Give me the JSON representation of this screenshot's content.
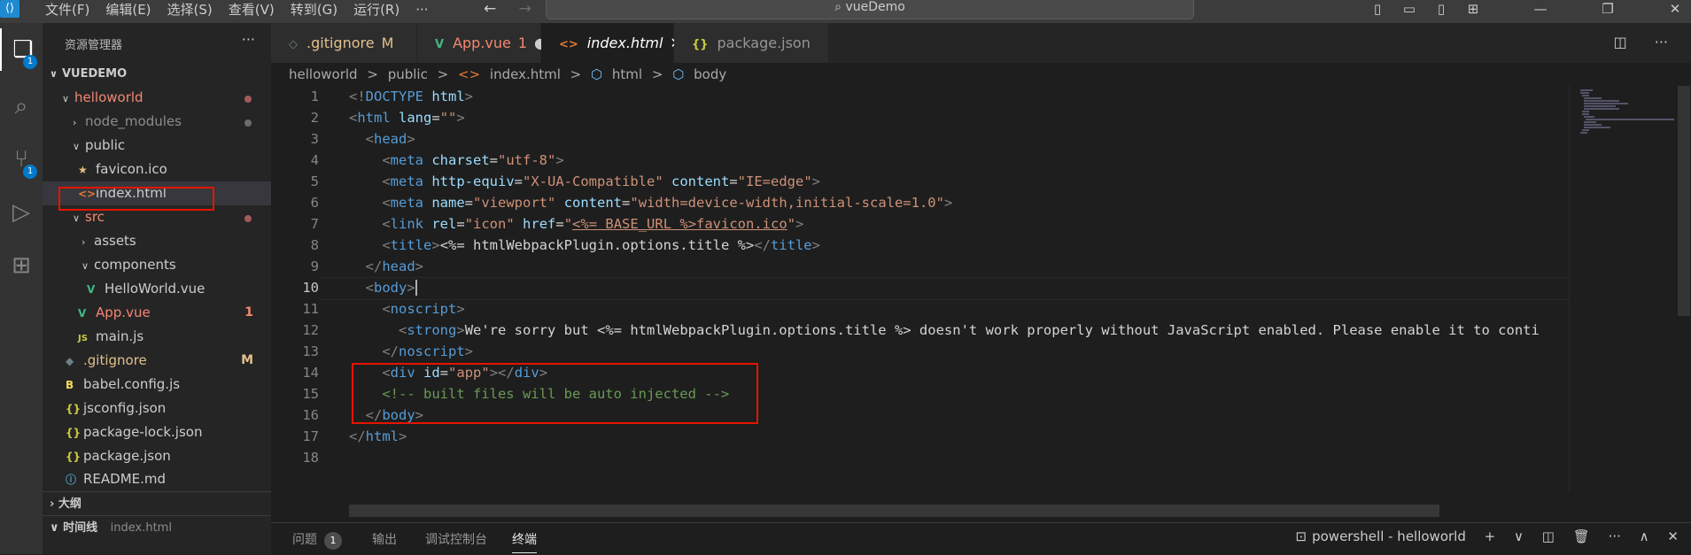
{
  "titlebar": {
    "menus": [
      "文件(F)",
      "编辑(E)",
      "选择(S)",
      "查看(V)",
      "转到(G)",
      "运行(R)",
      "···"
    ],
    "search": "vueDemo"
  },
  "activity": {
    "explorer_badge": "1",
    "scm_badge": "1"
  },
  "sidebar": {
    "title": "资源管理器",
    "more": "···",
    "root": "VUEDEMO",
    "items": [
      {
        "label": "helloworld",
        "color": "#f48771"
      },
      {
        "label": "node_modules",
        "color": "#8c8c8c"
      },
      {
        "label": "public",
        "color": "#cccccc"
      },
      {
        "label": "favicon.ico",
        "color": "#cccccc"
      },
      {
        "label": "index.html",
        "color": "#cccccc"
      },
      {
        "label": "src",
        "color": "#f48771"
      },
      {
        "label": "assets",
        "color": "#cccccc"
      },
      {
        "label": "components",
        "color": "#cccccc"
      },
      {
        "label": "HelloWorld.vue",
        "color": "#cccccc"
      },
      {
        "label": "App.vue",
        "color": "#f48771",
        "mark": "1"
      },
      {
        "label": "main.js",
        "color": "#cccccc"
      },
      {
        "label": ".gitignore",
        "color": "#e2c08d",
        "mark": "M"
      },
      {
        "label": "babel.config.js",
        "color": "#cccccc"
      },
      {
        "label": "jsconfig.json",
        "color": "#cccccc"
      },
      {
        "label": "package-lock.json",
        "color": "#cccccc"
      },
      {
        "label": "package.json",
        "color": "#cccccc"
      },
      {
        "label": "README.md",
        "color": "#cccccc"
      }
    ],
    "outline": "大纲",
    "timeline": "时间线",
    "timeline_file": "index.html"
  },
  "tabs": [
    {
      "label": ".gitignore",
      "suffix": "M",
      "icon": "◇"
    },
    {
      "label": "App.vue",
      "suffix": "1",
      "icon": "V"
    },
    {
      "label": "index.html",
      "suffix": "✕",
      "icon": "<>"
    },
    {
      "label": "package.json",
      "suffix": "",
      "icon": "{}"
    }
  ],
  "breadcrumb": [
    "helloworld",
    ">",
    "public",
    ">",
    "index.html",
    ">",
    "html",
    ">",
    "body"
  ],
  "editor": {
    "line_numbers": [
      "1",
      "2",
      "3",
      "4",
      "5",
      "6",
      "7",
      "8",
      "9",
      "10",
      "11",
      "12",
      "13",
      "14",
      "15",
      "16",
      "17",
      "18"
    ],
    "current_line": "10"
  },
  "panel": {
    "tabs": [
      "问题",
      "输出",
      "调试控制台",
      "终端"
    ],
    "problems_count": "1",
    "terminal": "powershell - helloworld"
  }
}
